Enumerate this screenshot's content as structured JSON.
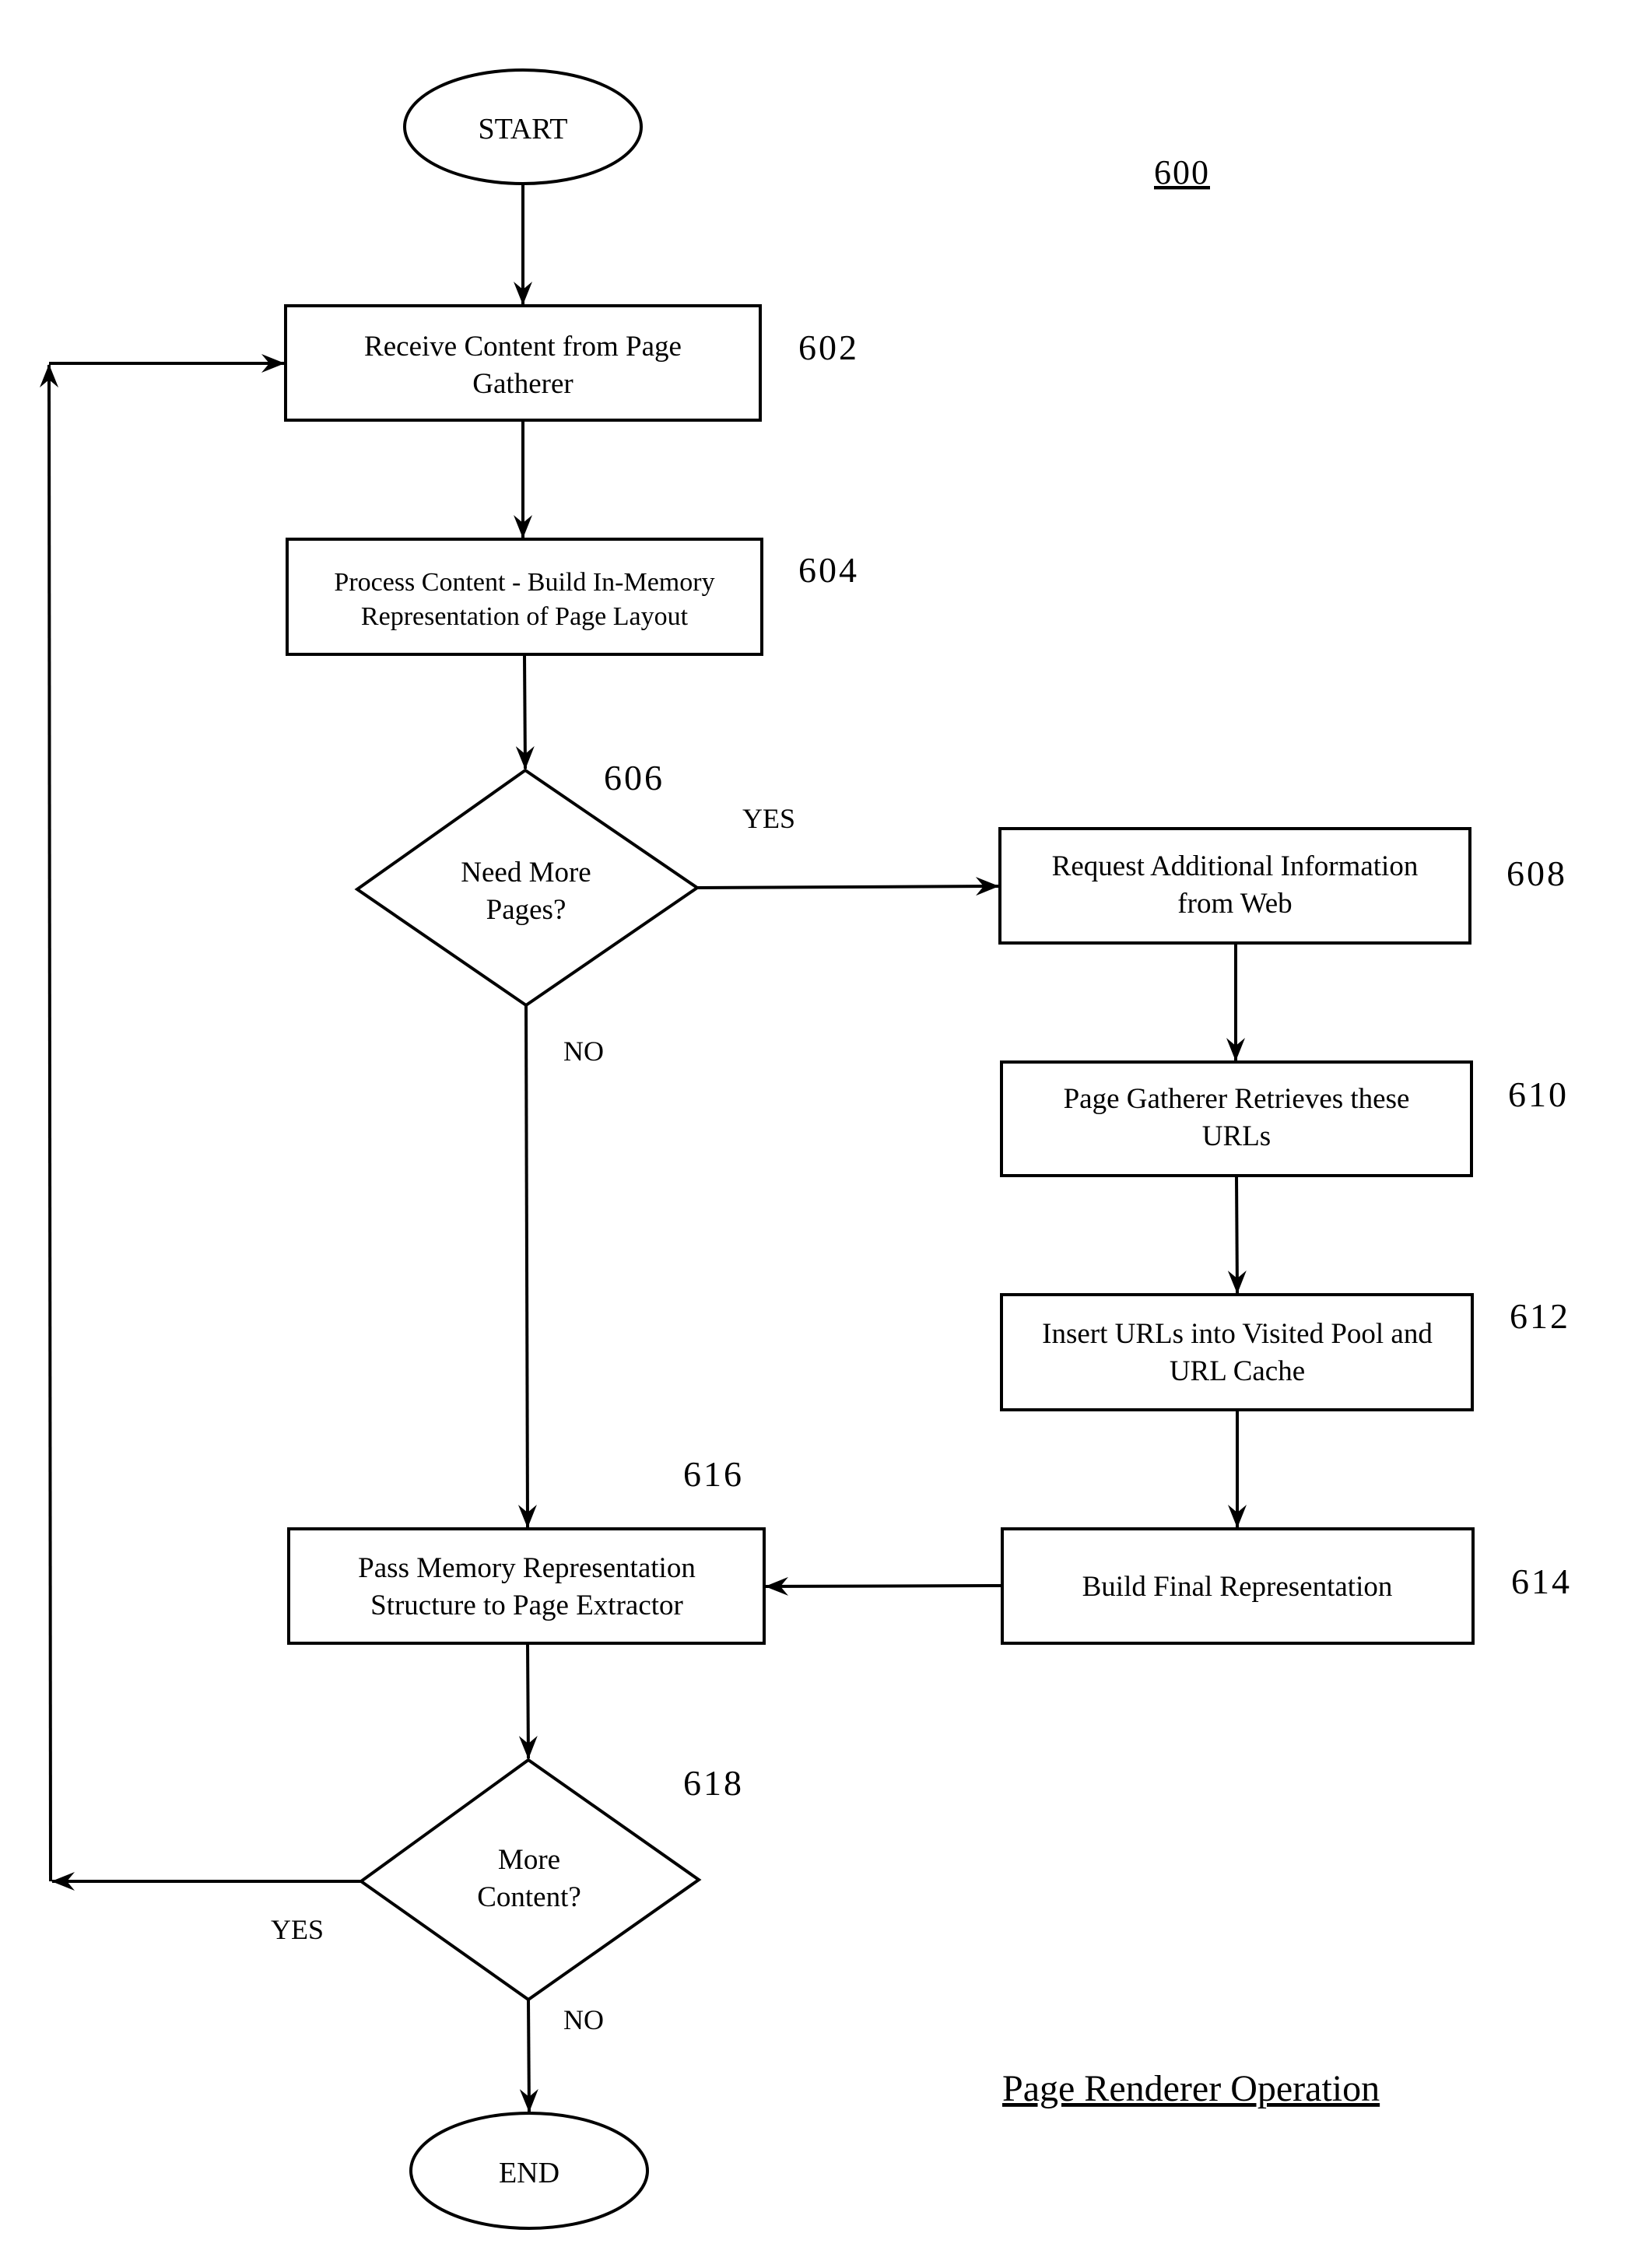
{
  "figure": {
    "number": "600",
    "caption": "Page Renderer Operation"
  },
  "nodes": {
    "start": {
      "label": "START"
    },
    "n602": {
      "ref": "602",
      "lines": [
        "Receive Content from Page",
        "Gatherer"
      ]
    },
    "n604": {
      "ref": "604",
      "lines": [
        "Process Content - Build In-Memory",
        "Representation of Page Layout"
      ]
    },
    "n606": {
      "ref": "606",
      "lines": [
        "Need More",
        "Pages?"
      ]
    },
    "n608": {
      "ref": "608",
      "lines": [
        "Request Additional Information",
        "from Web"
      ]
    },
    "n610": {
      "ref": "610",
      "lines": [
        "Page Gatherer Retrieves these",
        "URLs"
      ]
    },
    "n612": {
      "ref": "612",
      "lines": [
        "Insert URLs into Visited Pool and",
        "URL Cache"
      ]
    },
    "n614": {
      "ref": "614",
      "lines": [
        "Build Final Representation"
      ]
    },
    "n616": {
      "ref": "616",
      "lines": [
        "Pass Memory Representation",
        "Structure to Page Extractor"
      ]
    },
    "n618": {
      "ref": "618",
      "lines": [
        "More",
        "Content?"
      ]
    },
    "end": {
      "label": "END"
    }
  },
  "branches": {
    "n606_yes": "YES",
    "n606_no": "NO",
    "n618_yes": "YES",
    "n618_no": "NO"
  },
  "edges": [
    {
      "from": "start",
      "to": "n602"
    },
    {
      "from": "n602",
      "to": "n604"
    },
    {
      "from": "n604",
      "to": "n606"
    },
    {
      "from": "n606",
      "to": "n608",
      "label": "YES"
    },
    {
      "from": "n606",
      "to": "n616",
      "label": "NO"
    },
    {
      "from": "n608",
      "to": "n610"
    },
    {
      "from": "n610",
      "to": "n612"
    },
    {
      "from": "n612",
      "to": "n614"
    },
    {
      "from": "n614",
      "to": "n616"
    },
    {
      "from": "n616",
      "to": "n618"
    },
    {
      "from": "n618",
      "to": "n602",
      "label": "YES"
    },
    {
      "from": "n618",
      "to": "end",
      "label": "NO"
    }
  ]
}
